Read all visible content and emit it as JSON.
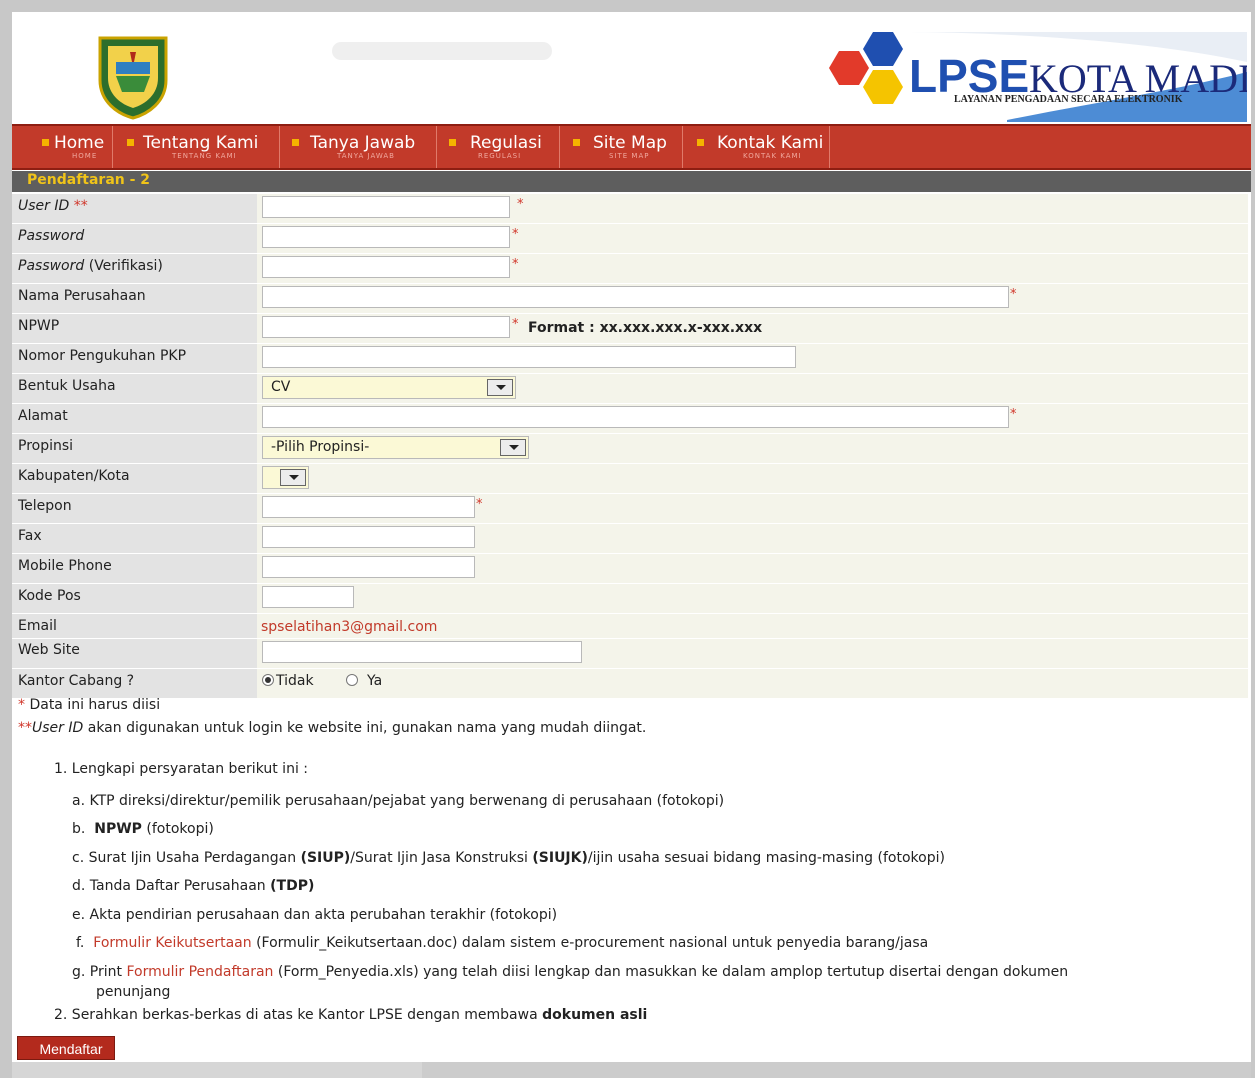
{
  "header": {
    "brand": "LPSE KOTA MADIUN",
    "brand_short": "LPSE",
    "brand_city": "KOTA MADIUN",
    "tagline": "LAYANAN PENGADAAN SECARA ELEKTRONIK"
  },
  "nav": [
    {
      "label": "Home",
      "sub": "HOME"
    },
    {
      "label": "Tentang Kami",
      "sub": "TENTANG KAMI"
    },
    {
      "label": "Tanya Jawab",
      "sub": "TANYA JAWAB"
    },
    {
      "label": "Regulasi",
      "sub": "REGULASI"
    },
    {
      "label": "Site Map",
      "sub": "SITE MAP"
    },
    {
      "label": "Kontak Kami",
      "sub": "KONTAK KAMI"
    }
  ],
  "section_title": "Pendaftaran - 2",
  "form": {
    "user_id": {
      "label": "User ID",
      "stars": "**"
    },
    "password": {
      "label": "Password"
    },
    "password_verif": {
      "label_italic": "Password",
      "label_rest": "(Verifikasi)"
    },
    "nama_perusahaan": {
      "label": "Nama Perusahaan"
    },
    "npwp": {
      "label": "NPWP",
      "format": "Format : xx.xxx.xxx.x-xxx.xxx"
    },
    "pkp": {
      "label": "Nomor Pengukuhan PKP"
    },
    "bentuk_usaha": {
      "label": "Bentuk Usaha",
      "value": "CV"
    },
    "alamat": {
      "label": "Alamat"
    },
    "propinsi": {
      "label": "Propinsi",
      "value": "-Pilih Propinsi-"
    },
    "kabupaten": {
      "label": "Kabupaten/Kota"
    },
    "telepon": {
      "label": "Telepon"
    },
    "fax": {
      "label": "Fax"
    },
    "mobile": {
      "label": "Mobile Phone"
    },
    "kode_pos": {
      "label": "Kode Pos"
    },
    "email": {
      "label": "Email",
      "value": "spselatihan3@gmail.com"
    },
    "website": {
      "label": "Web Site"
    },
    "kantor_cabang": {
      "label": "Kantor Cabang ?",
      "option_no": "Tidak",
      "option_yes": "Ya"
    },
    "required_mark": "*"
  },
  "notes": {
    "required_star": "*",
    "required_text": "Data ini harus diisi",
    "userid_stars": "**",
    "userid_italic": "User ID",
    "userid_text": "akan digunakan untuk login ke website ini, gunakan nama yang mudah diingat."
  },
  "steps": {
    "step1": "1.  Lengkapi persyaratan berikut ini :",
    "a": "a.  KTP direksi/direktur/pemilik perusahaan/pejabat yang berwenang di perusahaan (fotokopi)",
    "b_prefix": "b.",
    "b_bold": "NPWP",
    "b_rest": "(fotokopi)",
    "c_prefix": "c.  Surat Ijin Usaha Perdagangan",
    "c_bold1": "(SIUP)",
    "c_mid": "/Surat Ijin Jasa Konstruksi",
    "c_bold2": "(SIUJK)",
    "c_rest": "/ijin usaha sesuai bidang masing-masing (fotokopi)",
    "d_prefix": "d.  Tanda Daftar Perusahaan",
    "d_bold": "(TDP)",
    "e": "e.  Akta pendirian perusahaan dan akta perubahan terakhir (fotokopi)",
    "f_prefix": "f.",
    "f_link": "Formulir Keikutsertaan",
    "f_rest": "(Formulir_Keikutsertaan.doc) dalam sistem e-procurement nasional untuk penyedia barang/jasa",
    "g_prefix": "g.  Print",
    "g_link": "Formulir Pendaftaran",
    "g_rest": "(Form_Penyedia.xls) yang telah diisi lengkap dan masukkan ke dalam amplop tertutup disertai dengan dokumen",
    "g_cont": "penunjang",
    "step2_text": "2.  Serahkan berkas-berkas di atas ke Kantor LPSE dengan membawa",
    "step2_bold": "dokumen asli"
  },
  "submit_label": "Mendaftar",
  "colors": {
    "nav": "#c23a2a",
    "section": "#5e5e5e",
    "title": "#f0c419",
    "link": "#c23a2a"
  }
}
